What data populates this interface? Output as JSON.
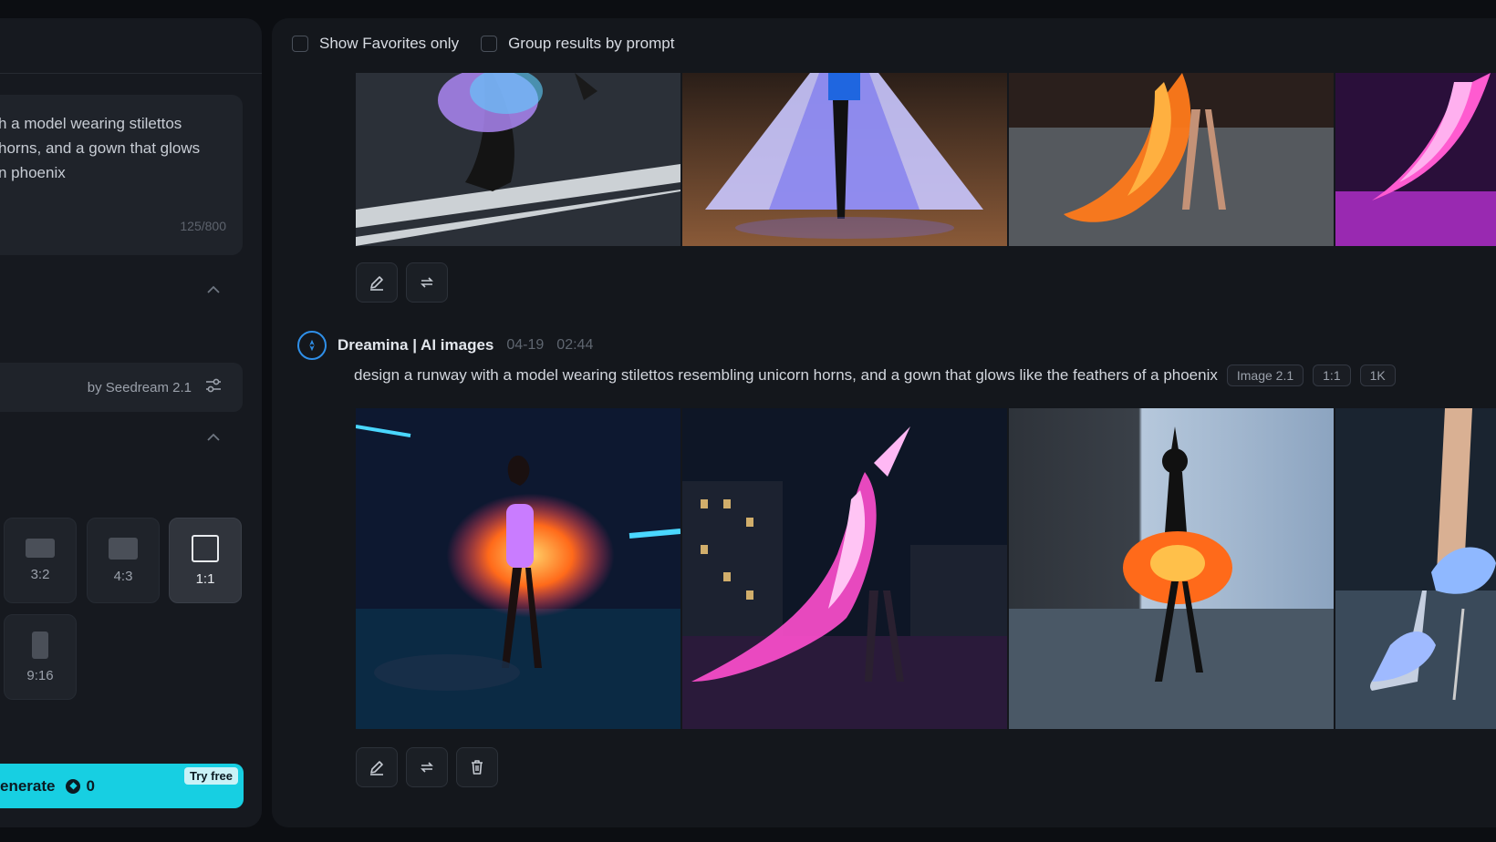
{
  "left_panel": {
    "prompt_text": "h a model wearing stilettos\nhorns, and a gown that glows\nn phoenix",
    "prompt_count": "125/800",
    "model_label": "by Seedream 2.1",
    "ratios": [
      {
        "label": "3:2",
        "active": false
      },
      {
        "label": "4:3",
        "active": false
      },
      {
        "label": "1:1",
        "active": true
      },
      {
        "label": "9:16",
        "active": false
      }
    ],
    "generate_label": "enerate",
    "credits": "0",
    "try_free": "Try free"
  },
  "toolbar": {
    "favorites_label": "Show Favorites only",
    "group_label": "Group results by prompt"
  },
  "generation": {
    "app_name": "Dreamina | AI images",
    "date": "04-19",
    "time": "02:44",
    "prompt": "design a runway with a model wearing stilettos resembling unicorn horns, and a gown that glows like the feathers of a phoenix",
    "tags": [
      "Image 2.1",
      "1:1",
      "1K"
    ]
  },
  "icons": {
    "edit": "pencil-icon",
    "regenerate": "repeat-icon",
    "delete": "trash-icon",
    "settings": "sliders-icon",
    "collapse": "chevron-up-icon",
    "avatar": "dreamina-logo-icon",
    "credit": "credit-coin-icon"
  },
  "colors": {
    "accent": "#17cfe2",
    "panel": "#16191f",
    "main_bg": "#14171c",
    "avatar_ring": "#2f8fe8"
  }
}
